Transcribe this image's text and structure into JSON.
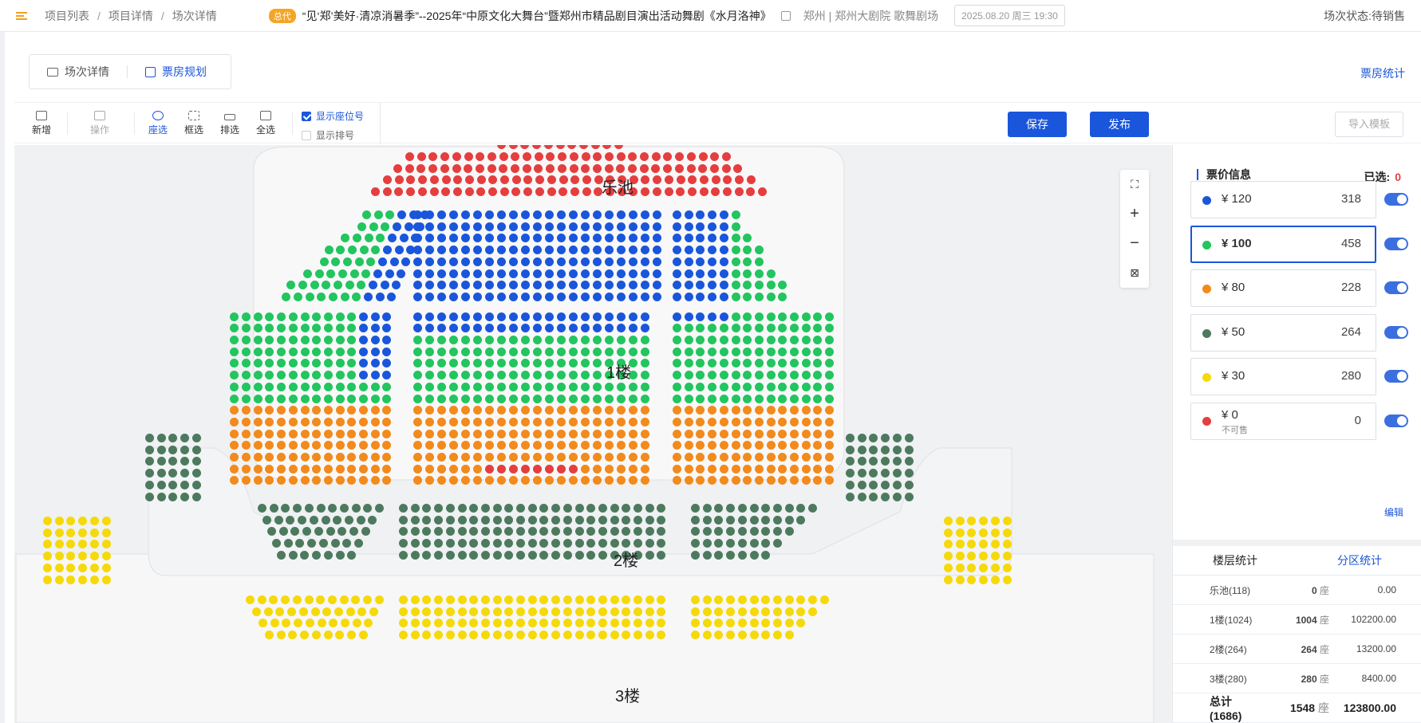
{
  "breadcrumb": [
    "项目列表",
    "项目详情",
    "场次详情"
  ],
  "header": {
    "tag": "总代",
    "title": "“见‘郑’美好·清凉消暑季”--2025年“中原文化大舞台”暨郑州市精品剧目演出活动舞剧《水月洛神》",
    "venue": "郑州 | 郑州大剧院 歌舞剧场",
    "datetime": "2025.08.20 周三 19:30",
    "status": "场次状态:待销售"
  },
  "tabs": [
    {
      "label": "场次详情"
    },
    {
      "label": "票房规划"
    }
  ],
  "box_office_link": "票房统计",
  "toolbar": {
    "add": "新增",
    "operate": "操作",
    "seat": "座选",
    "box": "框选",
    "row": "排选",
    "all": "全选",
    "show_seat_no": "显示座位号",
    "show_row_no": "显示排号",
    "save": "保存",
    "publish": "发布",
    "import_template": "导入模板"
  },
  "map": {
    "zones": [
      "乐池",
      "1楼",
      "2楼",
      "3楼"
    ]
  },
  "panel": {
    "title": "票价信息",
    "selected_label": "已选:",
    "selected_count": "0",
    "edit": "编辑",
    "prices": [
      {
        "label": "¥ 120",
        "count": "318",
        "color": "#1a56db",
        "sub": ""
      },
      {
        "label": "¥ 100",
        "count": "458",
        "color": "#22c55e",
        "sub": ""
      },
      {
        "label": "¥ 80",
        "count": "228",
        "color": "#f28a1c",
        "sub": ""
      },
      {
        "label": "¥ 50",
        "count": "264",
        "color": "#4d7a5f",
        "sub": ""
      },
      {
        "label": "¥ 30",
        "count": "280",
        "color": "#f5d90a",
        "sub": ""
      },
      {
        "label": "¥ 0",
        "count": "0",
        "color": "#e53e3e",
        "sub": "不可售"
      }
    ]
  },
  "stats": {
    "tab_floor": "楼层统计",
    "tab_zone": "分区统计",
    "rows": [
      {
        "name": "乐池(118)",
        "seats": "0",
        "unit": "座",
        "amount": "0.00"
      },
      {
        "name": "1楼(1024)",
        "seats": "1004",
        "unit": "座",
        "amount": "102200.00"
      },
      {
        "name": "2楼(264)",
        "seats": "264",
        "unit": "座",
        "amount": "13200.00"
      },
      {
        "name": "3楼(280)",
        "seats": "280",
        "unit": "座",
        "amount": "8400.00"
      }
    ],
    "total": {
      "name": "总计(1686)",
      "seats": "1548",
      "unit": "座",
      "amount": "123800.00"
    }
  },
  "colors": {
    "accent": "#1a56db",
    "price_120": "#1a56db",
    "price_100": "#22c55e",
    "price_80": "#f28a1c",
    "price_50": "#4d7a5f",
    "price_30": "#f5d90a",
    "price_0": "#e53e3e"
  }
}
